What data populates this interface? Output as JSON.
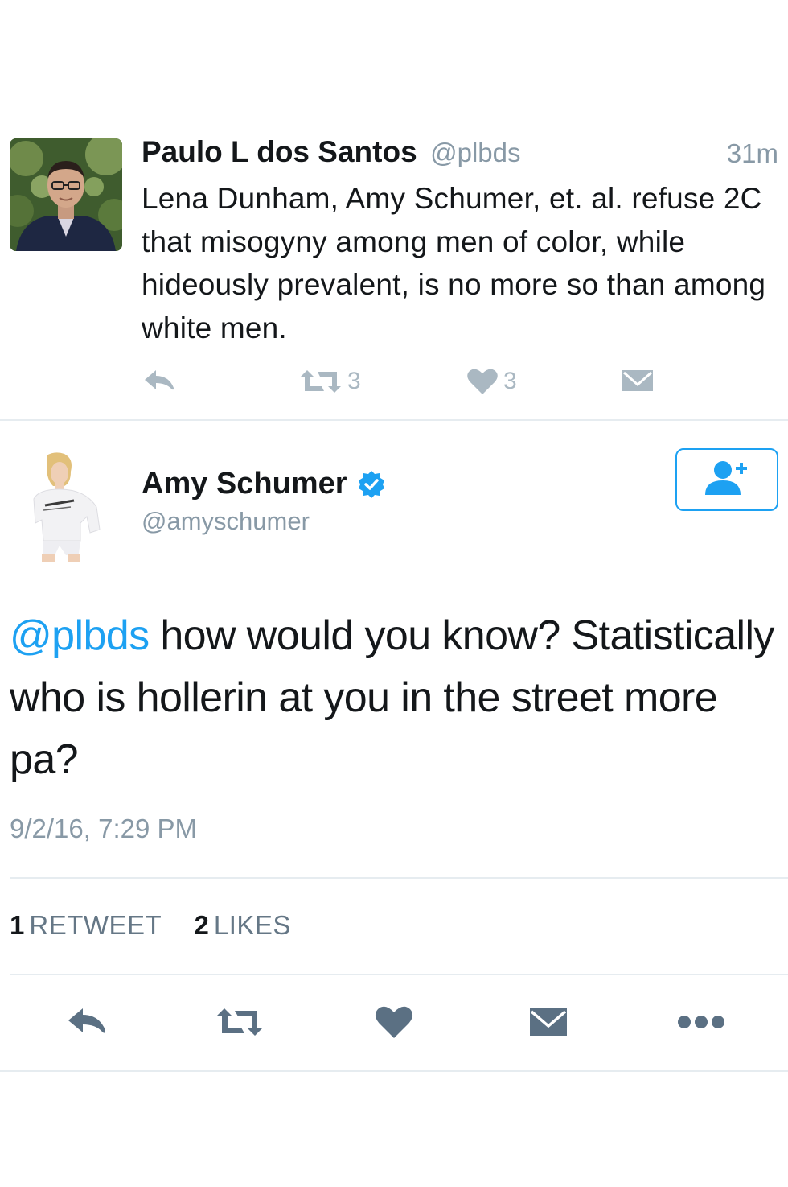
{
  "reply": {
    "author_name": "Paulo L dos Santos",
    "author_handle": "@plbds",
    "time": "31m",
    "text": "Lena Dunham, Amy Schumer, et. al. refuse 2C that misogyny among men of color, while hideously prevalent, is no more so than among white men.",
    "retweet_count": "3",
    "like_count": "3"
  },
  "tweet": {
    "author_name": "Amy Schumer",
    "author_handle": "@amyschumer",
    "mention": "@plbds",
    "text": " how would you know? Statistically who is hollerin at you in the street more pa?",
    "timestamp": "9/2/16, 7:29 PM",
    "retweets_count": "1",
    "retweets_label": "RETWEET",
    "likes_count": "2",
    "likes_label": "LIKES"
  },
  "colors": {
    "link_blue": "#1da1f2",
    "secondary_gray": "#8899a6",
    "faint_icon": "#aab8c2",
    "action_icon": "#5b7083",
    "divider": "#e6ecf0"
  },
  "icons": {
    "reply": "reply-icon",
    "retweet": "retweet-icon",
    "like": "heart-icon",
    "message": "envelope-icon",
    "more": "more-dots-icon",
    "follow": "add-user-icon",
    "verified": "verified-badge-icon"
  }
}
